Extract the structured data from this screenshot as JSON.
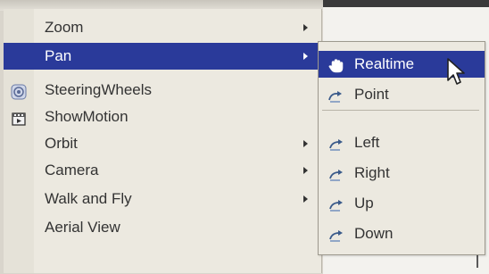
{
  "menu": {
    "items": [
      {
        "label": "Zoom",
        "has_submenu": true,
        "highlighted": false,
        "icon": null
      },
      {
        "label": "Pan",
        "has_submenu": true,
        "highlighted": true,
        "icon": null
      },
      {
        "label": "SteeringWheels",
        "has_submenu": false,
        "highlighted": false,
        "icon": "steeringwheel-icon"
      },
      {
        "label": "ShowMotion",
        "has_submenu": false,
        "highlighted": false,
        "icon": "showmotion-icon"
      },
      {
        "label": "Orbit",
        "has_submenu": true,
        "highlighted": false,
        "icon": null
      },
      {
        "label": "Camera",
        "has_submenu": true,
        "highlighted": false,
        "icon": null
      },
      {
        "label": "Walk and Fly",
        "has_submenu": true,
        "highlighted": false,
        "icon": null
      },
      {
        "label": "Aerial View",
        "has_submenu": false,
        "highlighted": false,
        "icon": null
      }
    ]
  },
  "submenu": {
    "items": [
      {
        "label": "Realtime",
        "highlighted": true,
        "icon": "pan-hand-icon"
      },
      {
        "label": "Point",
        "highlighted": false,
        "icon": "pan-point-icon"
      },
      {
        "label": "Left",
        "highlighted": false,
        "icon": "pan-left-icon"
      },
      {
        "label": "Right",
        "highlighted": false,
        "icon": "pan-right-icon"
      },
      {
        "label": "Up",
        "highlighted": false,
        "icon": "pan-up-icon"
      },
      {
        "label": "Down",
        "highlighted": false,
        "icon": "pan-down-icon"
      }
    ]
  },
  "colors": {
    "highlight": "#2a3a9a",
    "menu_bg": "#ece9e0",
    "text": "#333333"
  }
}
